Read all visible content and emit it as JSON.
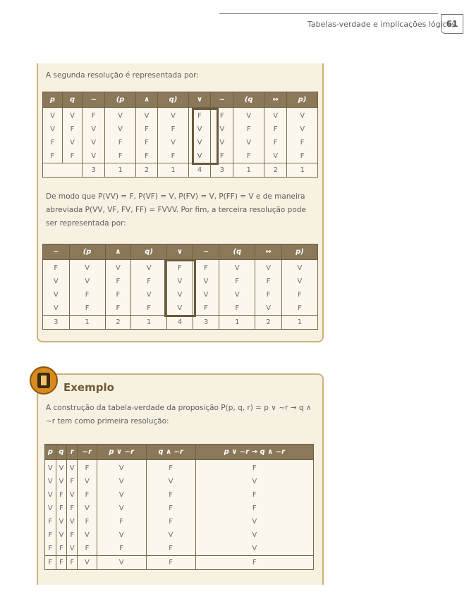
{
  "header": {
    "title": "Tabelas-verdade e implicações lógicas",
    "page_number": "61"
  },
  "box1": {
    "intro": "A segunda resolução é representada por:",
    "table1": {
      "headers": [
        "p",
        "q",
        "~",
        "(p",
        "∧",
        "q)",
        "∨",
        "~",
        "(q",
        "↔",
        "p)"
      ],
      "rows": [
        [
          "V",
          "V",
          "F",
          "V",
          "V",
          "V",
          "F",
          "F",
          "V",
          "V",
          "V"
        ],
        [
          "V",
          "F",
          "V",
          "V",
          "F",
          "F",
          "V",
          "V",
          "F",
          "F",
          "V"
        ],
        [
          "F",
          "V",
          "V",
          "F",
          "F",
          "V",
          "V",
          "V",
          "V",
          "F",
          "F"
        ],
        [
          "F",
          "F",
          "V",
          "F",
          "F",
          "F",
          "V",
          "F",
          "F",
          "V",
          "F"
        ]
      ],
      "order": [
        "3",
        "1",
        "2",
        "1",
        "4",
        "3",
        "1",
        "2",
        "1"
      ]
    },
    "paragraph": "De modo que P(VV) = F, P(VF) = V, P(FV) = V, P(FF) = V e de maneira abreviada P(VV, VF, FV, FF) = FVVV. Por fim, a terceira resolução pode ser representada por:",
    "table2": {
      "headers": [
        "~",
        "(p",
        "∧",
        "q)",
        "∨",
        "~",
        "(q",
        "↔",
        "p)"
      ],
      "rows": [
        [
          "F",
          "V",
          "V",
          "V",
          "F",
          "F",
          "V",
          "V",
          "V"
        ],
        [
          "V",
          "V",
          "F",
          "F",
          "V",
          "V",
          "F",
          "F",
          "V"
        ],
        [
          "V",
          "F",
          "F",
          "V",
          "V",
          "V",
          "V",
          "F",
          "F"
        ],
        [
          "V",
          "F",
          "F",
          "F",
          "V",
          "F",
          "F",
          "V",
          "F"
        ]
      ],
      "order": [
        "3",
        "1",
        "2",
        "1",
        "4",
        "3",
        "1",
        "2",
        "1"
      ]
    }
  },
  "example": {
    "title": "Exemplo",
    "intro": "A construção da tabela-verdade da proposição P(p, q, r) = p ∨ ~r → q ∧ ~r tem como primeira resolução:",
    "table": {
      "headers": [
        "p",
        "q",
        "r",
        "~r",
        "p ∨ ~r",
        "q ∧ ~r",
        "p ∨ ~r → q ∧ ~r"
      ],
      "rows": [
        [
          "V",
          "V",
          "V",
          "F",
          "V",
          "F",
          "F"
        ],
        [
          "V",
          "V",
          "F",
          "V",
          "V",
          "V",
          "V"
        ],
        [
          "V",
          "F",
          "V",
          "F",
          "V",
          "F",
          "F"
        ],
        [
          "V",
          "F",
          "F",
          "V",
          "V",
          "F",
          "F"
        ],
        [
          "F",
          "V",
          "V",
          "F",
          "F",
          "F",
          "V"
        ],
        [
          "F",
          "V",
          "F",
          "V",
          "V",
          "V",
          "V"
        ],
        [
          "F",
          "F",
          "V",
          "F",
          "F",
          "F",
          "V"
        ],
        [
          "F",
          "F",
          "F",
          "V",
          "V",
          "F",
          "F"
        ]
      ]
    }
  }
}
